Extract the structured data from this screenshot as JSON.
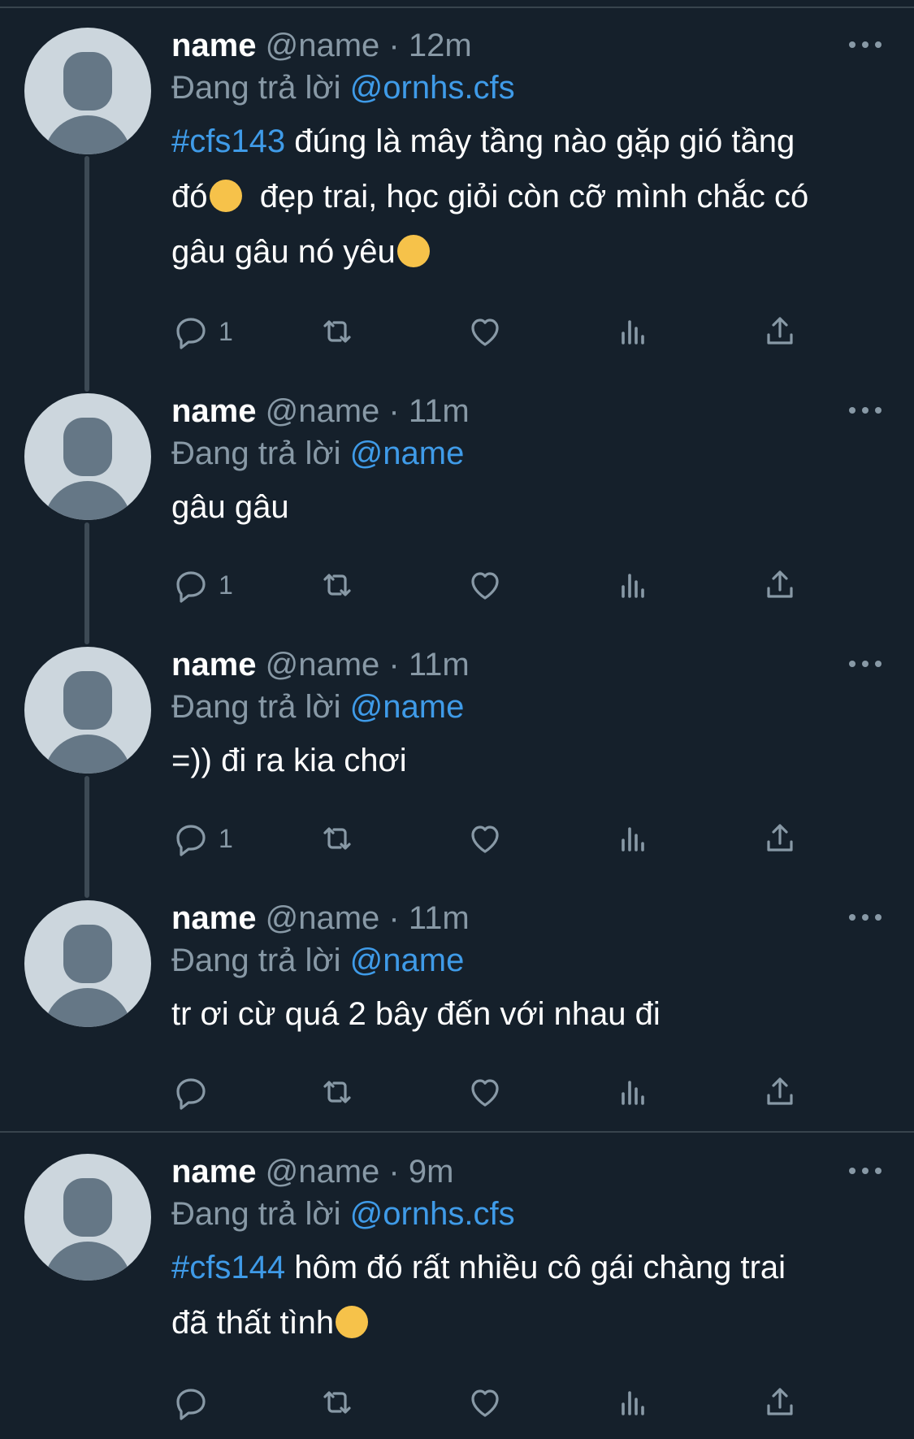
{
  "tweets": [
    {
      "name": "name",
      "handle": "@name",
      "dot": "·",
      "time": "12m",
      "reply_prefix": "Đang trả lời",
      "reply_to": "@ornhs.cfs",
      "hashtag": "#cfs143",
      "text_1": "đúng là mây tầng nào gặp gió tầng",
      "text_2": "đó",
      "emoji_1": "loudly-crying-face",
      "text_3": "đẹp trai, học giỏi còn cỡ mình chắc có",
      "text_4": "gâu gâu nó yêu",
      "emoji_2": "pensive-face",
      "reply_count": "1"
    },
    {
      "name": "name",
      "handle": "@name",
      "dot": "·",
      "time": "11m",
      "reply_prefix": "Đang trả lời",
      "reply_to": "@name",
      "text": "gâu gâu",
      "reply_count": "1"
    },
    {
      "name": "name",
      "handle": "@name",
      "dot": "·",
      "time": "11m",
      "reply_prefix": "Đang trả lời",
      "reply_to": "@name",
      "text": "=)) đi ra kia chơi",
      "reply_count": "1"
    },
    {
      "name": "name",
      "handle": "@name",
      "dot": "·",
      "time": "11m",
      "reply_prefix": "Đang trả lời",
      "reply_to": "@name",
      "text": "tr ơi cừ quá 2 bây đến với nhau đi",
      "reply_count": ""
    },
    {
      "name": "name",
      "handle": "@name",
      "dot": "·",
      "time": "9m",
      "reply_prefix": "Đang trả lời",
      "reply_to": "@ornhs.cfs",
      "hashtag": "#cfs144",
      "text_1": "hôm đó rất nhiều cô gái chàng trai",
      "text_2": "đã thất tình",
      "emoji_1": "smiling-face-with-hearts",
      "reply_count": ""
    }
  ],
  "colors": {
    "background": "#15202b",
    "link": "#3f9be8",
    "muted": "#8899a6",
    "divider": "#38444d"
  }
}
